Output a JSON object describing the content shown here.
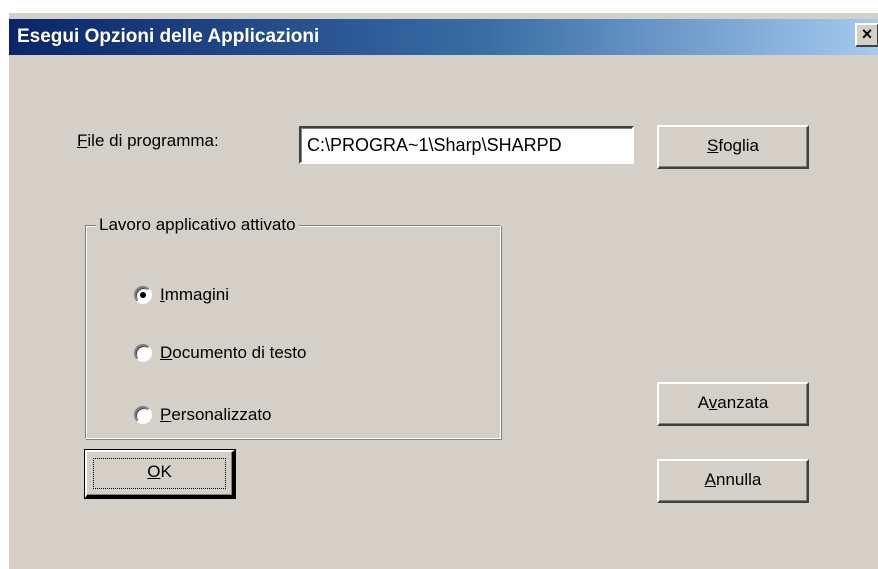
{
  "window": {
    "title": "Esegui Opzioni delle Applicazioni",
    "close_glyph": "×",
    "close_icon": "close-icon"
  },
  "file": {
    "label_prefix": "",
    "label_hotkey": "F",
    "label_rest": "ile di programma:",
    "value": "C:\\PROGRA~1\\Sharp\\SHARPD"
  },
  "buttons": {
    "browse": {
      "hotkey": "S",
      "rest": "foglia"
    },
    "advanced": {
      "before": "A",
      "hotkey": "v",
      "rest": "anzata"
    },
    "ok": {
      "hotkey": "O",
      "rest": "K"
    },
    "cancel": {
      "hotkey": "A",
      "rest": "nnulla"
    }
  },
  "group": {
    "legend": "Lavoro applicativo attivato",
    "options": [
      {
        "hotkey": "I",
        "rest": "mmagini",
        "selected": true
      },
      {
        "hotkey": "D",
        "rest": "ocumento di testo",
        "selected": false
      },
      {
        "hotkey": "P",
        "rest": "ersonalizzato",
        "selected": false
      }
    ]
  },
  "colors": {
    "dialog_bg": "#d4d0c8",
    "titlebar_start": "#0a246a",
    "titlebar_end": "#a6caf0",
    "title_text": "#ffffff"
  }
}
